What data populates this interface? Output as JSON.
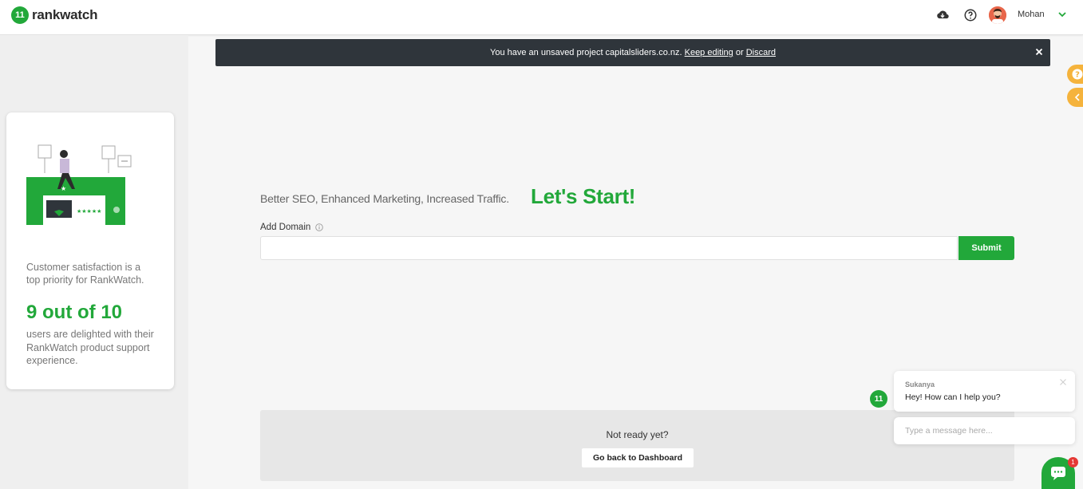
{
  "header": {
    "logo_text": "rankwatch",
    "logo_mark": "11",
    "username": "Mohan",
    "icons": [
      "cloud-download-icon",
      "help-circle-icon",
      "chevron-down-icon"
    ]
  },
  "notice": {
    "message": "You have an unsaved project capitalsliders.co.nz.",
    "keep_editing": "Keep editing",
    "or": "or",
    "discard": "Discard"
  },
  "promo": {
    "text1": "Customer satisfaction is a top priority for RankWatch.",
    "highlight": "9 out of 10",
    "text2": "users are delighted with their RankWatch product support experience."
  },
  "main": {
    "tagline": "Better SEO, Enhanced Marketing, Increased Traffic.",
    "headline": "Let's Start!",
    "add_domain_label": "Add Domain",
    "domain_value": "",
    "submit_label": "Submit"
  },
  "footer_box": {
    "text": "Not ready yet?",
    "button_label": "Go back to Dashboard"
  },
  "chat": {
    "agent_name": "Sukanya",
    "message": "Hey! How can I help you?",
    "input_placeholder": "Type a message here...",
    "badge_count": "1"
  },
  "colors": {
    "brand_green": "#22a83a",
    "notice_bg": "#2f353b",
    "side_tab": "#f5b33c"
  }
}
